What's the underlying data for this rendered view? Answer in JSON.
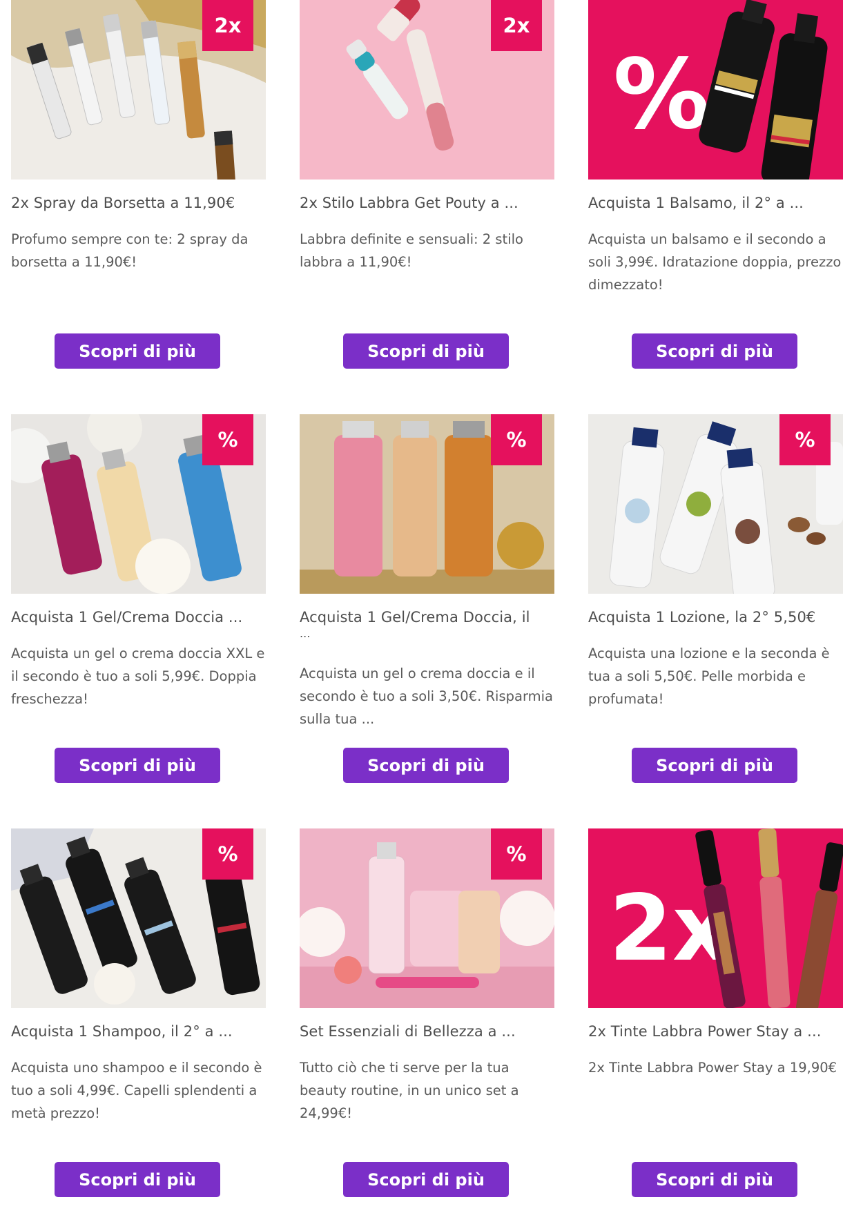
{
  "colors": {
    "badge": "#e5115d",
    "button": "#7b2fc8",
    "text": "#555555"
  },
  "cards": [
    {
      "image_icon": "perfume-spray-image",
      "badge": "2x",
      "title": "2x Spray da Borsetta a 11,90€",
      "description": "Profumo sempre con te: 2 spray da borsetta a 11,90€!",
      "button": "Scopri di più"
    },
    {
      "image_icon": "lipstick-image",
      "badge": "2x",
      "title": "2x Stilo Labbra Get Pouty a ...",
      "description": "Labbra definite e sensuali: 2 stilo labbra a 11,90€!",
      "button": "Scopri di più"
    },
    {
      "image_icon": "conditioner-bottles-image",
      "badge": "",
      "overlay_text": "%",
      "title": "Acquista 1 Balsamo, il 2° a ...",
      "description": "Acquista un balsamo e il secondo a soli 3,99€. Idratazione doppia, prezzo dimezzato!",
      "button": "Scopri di più"
    },
    {
      "image_icon": "shower-gel-bottles-image",
      "badge": "%",
      "title": "Acquista 1 Gel/Crema Doccia ...",
      "description": "Acquista un gel o crema doccia XXL e il secondo è tuo a soli 5,99€. Doppia freschezza!",
      "button": "Scopri di più"
    },
    {
      "image_icon": "senses-shower-bottles-image",
      "badge": "%",
      "title": "Acquista 1 Gel/Crema Doccia, il",
      "title_cont": "...",
      "description": "Acquista un gel o crema doccia e il secondo è tuo a soli 3,50€. Risparmia sulla tua ...",
      "button": "Scopri di più"
    },
    {
      "image_icon": "care-lotion-bottles-image",
      "badge": "%",
      "title": "Acquista 1 Lozione, la 2° 5,50€",
      "description": "Acquista una lozione e la seconda è tua a soli 5,50€. Pelle morbida e profumata!",
      "button": "Scopri di più"
    },
    {
      "image_icon": "shampoo-bottles-image",
      "badge": "%",
      "title": "Acquista 1 Shampoo, il 2° a ...",
      "description": "Acquista uno shampoo e il secondo è tuo a soli 4,99€. Capelli splendenti a metà prezzo!",
      "button": "Scopri di più"
    },
    {
      "image_icon": "beauty-set-image",
      "badge": "%",
      "title": "Set Essenziali di Bellezza a ...",
      "description": "Tutto ciò che ti serve per la tua beauty routine, in un unico set a 24,99€!",
      "button": "Scopri di più"
    },
    {
      "image_icon": "lip-tints-image",
      "badge": "",
      "overlay_text": "2x",
      "title": "2x Tinte Labbra Power Stay a ...",
      "description": "2x Tinte Labbra Power Stay a 19,90€",
      "button": "Scopri di più"
    }
  ]
}
